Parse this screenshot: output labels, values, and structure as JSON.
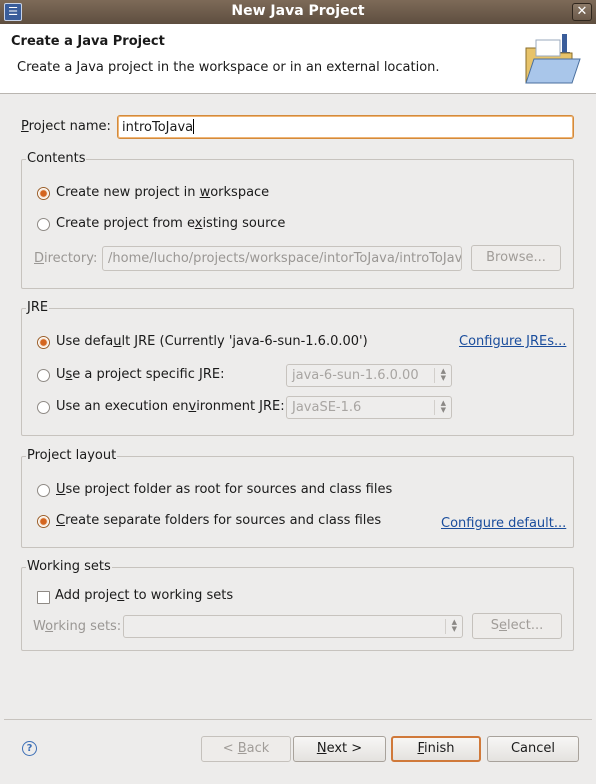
{
  "window": {
    "title": "New Java Project"
  },
  "banner": {
    "heading": "Create a Java Project",
    "description": "Create a Java project in the workspace or in an external location."
  },
  "project_name": {
    "label_prefix": "",
    "label_mnemonic": "P",
    "label_rest": "roject name:",
    "value": "introToJava"
  },
  "contents": {
    "title": "Contents",
    "new_in_workspace": {
      "pre": "Create new project in ",
      "mnemonic": "w",
      "post": "orkspace",
      "checked": true
    },
    "from_existing": {
      "pre": "Create project from e",
      "mnemonic": "x",
      "post": "isting source",
      "checked": false
    },
    "directory_label": {
      "pre": "",
      "mnemonic": "D",
      "post": "irectory:"
    },
    "directory_value": "/home/lucho/projects/workspace/intorToJava/introToJava",
    "browse_button": "Browse..."
  },
  "jre": {
    "title": "JRE",
    "default": {
      "pre": "Use defa",
      "mnemonic": "u",
      "post": "lt JRE (Currently 'java-6-sun-1.6.0.00')",
      "checked": true
    },
    "configure_link": "Configure JREs...",
    "specific": {
      "pre": "U",
      "mnemonic": "s",
      "post": "e a project specific JRE:",
      "checked": false
    },
    "specific_value": "java-6-sun-1.6.0.00",
    "execution_env": {
      "pre": "Use an execution en",
      "mnemonic": "v",
      "post": "ironment JRE:",
      "checked": false
    },
    "execution_env_value": "JavaSE-1.6"
  },
  "layout": {
    "title": "Project layout",
    "root": {
      "pre": "",
      "mnemonic": "U",
      "post": "se project folder as root for sources and class files",
      "checked": false
    },
    "separate": {
      "pre": "",
      "mnemonic": "C",
      "post": "reate separate folders for sources and class files",
      "checked": true
    },
    "configure_link": "Configure default..."
  },
  "working_sets": {
    "title": "Working sets",
    "add": {
      "pre": "Add proje",
      "mnemonic": "c",
      "post": "t to working sets",
      "checked": false
    },
    "label": {
      "pre": "W",
      "mnemonic": "o",
      "post": "rking sets:"
    },
    "value": "",
    "select_button": {
      "pre": "S",
      "mnemonic": "e",
      "post": "lect..."
    }
  },
  "footer": {
    "help_icon": "help-icon",
    "back_button": {
      "pre": "< ",
      "mnemonic": "B",
      "post": "ack"
    },
    "next_button": {
      "pre": "",
      "mnemonic": "N",
      "post": "ext >"
    },
    "finish_button": {
      "pre": "",
      "mnemonic": "F",
      "post": "inish"
    },
    "cancel_button": "Cancel"
  },
  "colors": {
    "accent": "#d4651f",
    "link": "#1a4d9c",
    "titlebar": "#6e5d4d",
    "default_button_border": "#d0793a"
  }
}
